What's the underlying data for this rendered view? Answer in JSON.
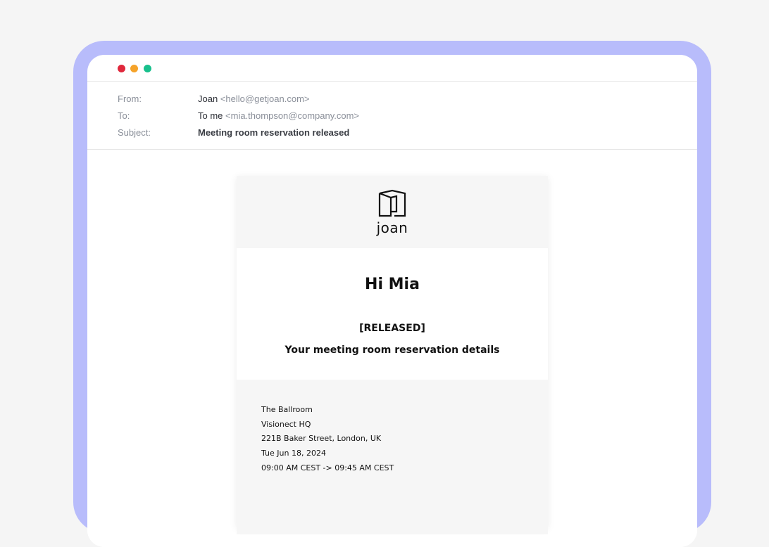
{
  "window": {
    "controls": [
      "close",
      "minimize",
      "maximize"
    ]
  },
  "email": {
    "from_label": "From:",
    "from_name": "Joan",
    "from_address": "<hello@getjoan.com>",
    "to_label": "To:",
    "to_name": "To me",
    "to_address": "<mia.thompson@company.com>",
    "subject_label": "Subject:",
    "subject": "Meeting room reservation released"
  },
  "message": {
    "logo_text": "joan",
    "greeting": "Hi Mia",
    "status": "[RELEASED]",
    "details_title": "Your meeting room reservation details",
    "details": {
      "room": "The Ballroom",
      "building": "Visionect HQ",
      "address": "221B Baker Street, London, UK",
      "date": "Tue Jun 18, 2024",
      "time": "09:00 AM CEST -> 09:45 AM CEST"
    }
  },
  "colors": {
    "frame": "#b8bcfb",
    "close": "#e0283c",
    "minimize": "#f5a32a",
    "maximize": "#18c08c"
  }
}
